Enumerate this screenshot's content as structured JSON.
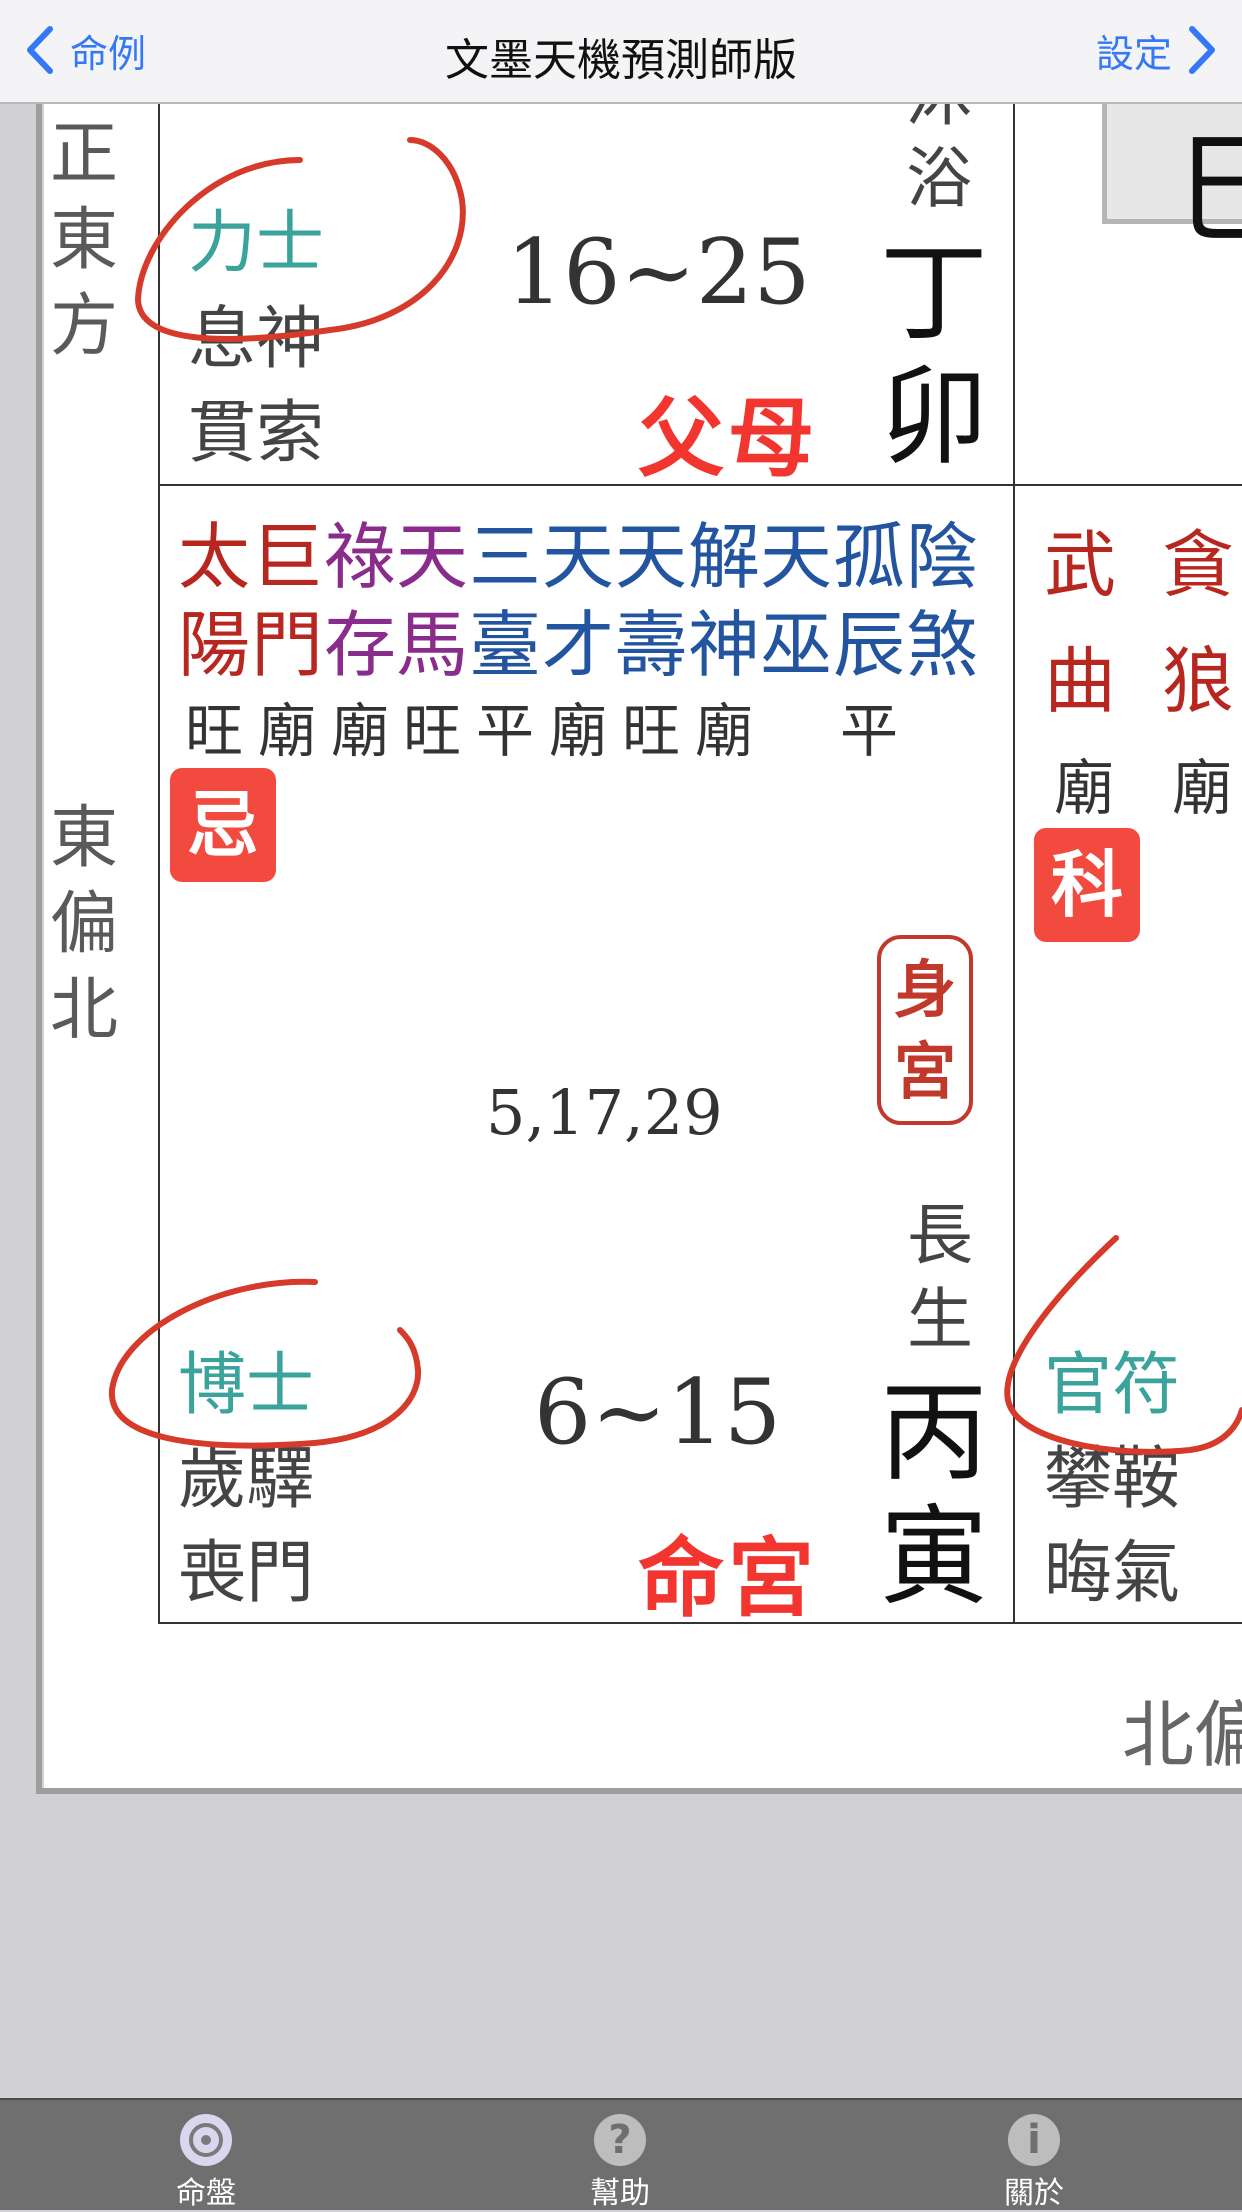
{
  "nav": {
    "back_label": "命例",
    "title": "文墨天機預測師版",
    "forward_label": "設定"
  },
  "directions": {
    "east": [
      "正",
      "東",
      "方"
    ],
    "east_north": [
      "東",
      "偏",
      "北"
    ],
    "north_partial": "北偏"
  },
  "right_top_box_char": "巳",
  "cell_mao": {
    "gods": [
      "力士",
      "息神",
      "貫索"
    ],
    "age_range": "16~25",
    "palace_name": "父母",
    "growth_stage": "沐浴",
    "stem_branch": [
      "丁",
      "卯"
    ]
  },
  "cell_yin": {
    "stars_row1": [
      "太",
      "巨",
      "祿",
      "天",
      "三",
      "天",
      "天",
      "解",
      "天",
      "孤",
      "陰"
    ],
    "stars_row2": [
      "陽",
      "門",
      "存",
      "馬",
      "臺",
      "才",
      "壽",
      "神",
      "巫",
      "辰",
      "煞"
    ],
    "brightness": [
      "旺",
      "廟",
      "廟",
      "旺",
      "平",
      "廟",
      "旺",
      "廟",
      "",
      "平",
      ""
    ],
    "transform_badge": "忌",
    "body_palace_label": [
      "身",
      "宮"
    ],
    "years": "5,17,29",
    "growth_stage": [
      "長",
      "生"
    ],
    "gods": [
      "博士",
      "歲驛",
      "喪門"
    ],
    "age_range": "6~15",
    "palace_name": "命宮",
    "stem_branch": [
      "丙",
      "寅"
    ]
  },
  "cell_chou_partial": {
    "stars_row1": [
      "武",
      "貪"
    ],
    "stars_row2": [
      "曲",
      "狼"
    ],
    "brightness": [
      "廟",
      "廟"
    ],
    "transform_badge": "科",
    "gods": [
      "官符",
      "攀鞍",
      "晦氣"
    ]
  },
  "tabs": [
    {
      "label": "命盤",
      "icon": "chart-disc-icon",
      "active": true
    },
    {
      "label": "幫助",
      "icon": "help-icon",
      "active": false
    },
    {
      "label": "關於",
      "icon": "info-icon",
      "active": false
    }
  ],
  "colors": {
    "accent": "#3478f6",
    "palace_red": "#f2362f",
    "god_teal": "#3aa39b",
    "annotation_red": "#d63a2a"
  }
}
